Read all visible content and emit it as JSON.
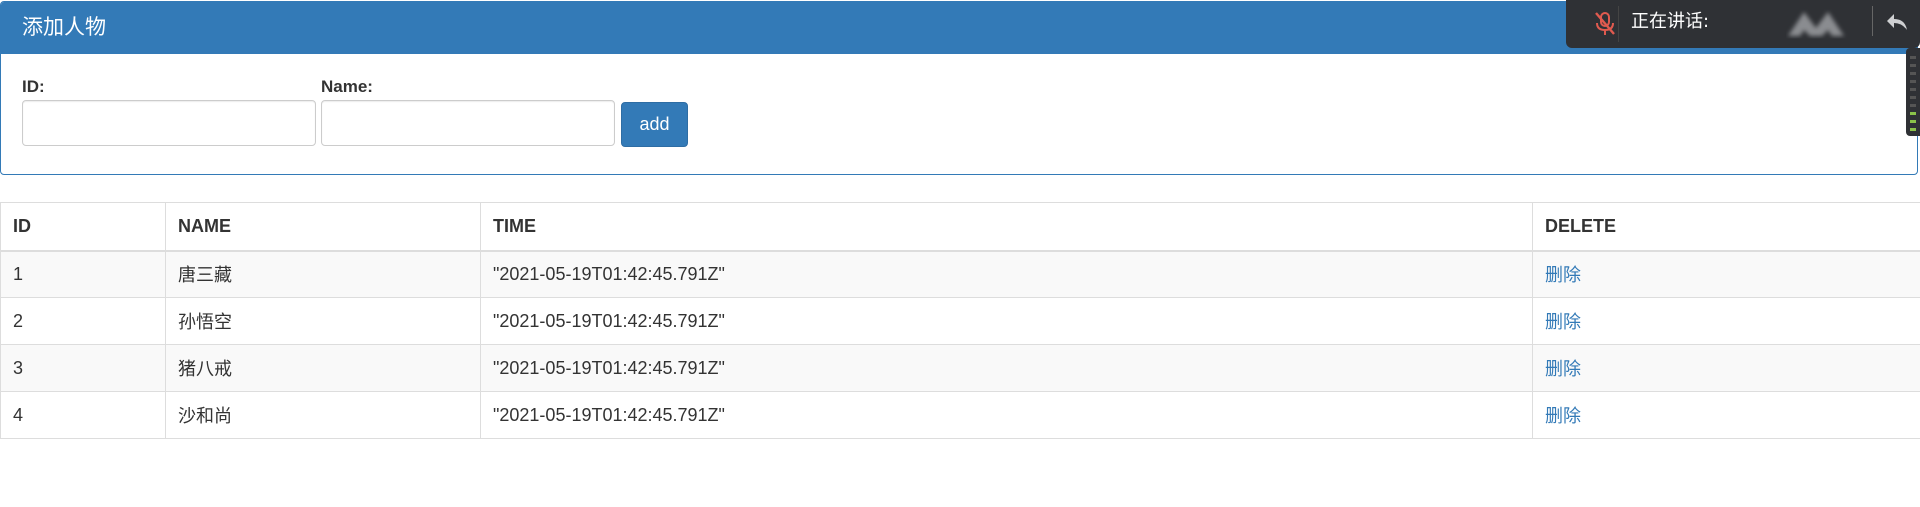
{
  "panel": {
    "title": "添加人物",
    "id_label": "ID:",
    "name_label": "Name:",
    "id_value": "",
    "name_value": "",
    "add_label": "add"
  },
  "table": {
    "headers": [
      "ID",
      "NAME",
      "TIME",
      "DELETE"
    ],
    "rows": [
      {
        "id": "1",
        "name": "唐三藏",
        "time": "\"2021-05-19T01:42:45.791Z\"",
        "action": "删除"
      },
      {
        "id": "2",
        "name": "孙悟空",
        "time": "\"2021-05-19T01:42:45.791Z\"",
        "action": "删除"
      },
      {
        "id": "3",
        "name": "猪八戒",
        "time": "\"2021-05-19T01:42:45.791Z\"",
        "action": "删除"
      },
      {
        "id": "4",
        "name": "沙和尚",
        "time": "\"2021-05-19T01:42:45.791Z\"",
        "action": "删除"
      }
    ]
  },
  "voice": {
    "speaking_label": "正在讲话:",
    "mic_icon": "mic-muted-icon",
    "back_icon": "reply-arrow-icon"
  },
  "colors": {
    "primary": "#337ab7",
    "overlay": "#2f3135",
    "mic_muted": "#e05a4f"
  }
}
